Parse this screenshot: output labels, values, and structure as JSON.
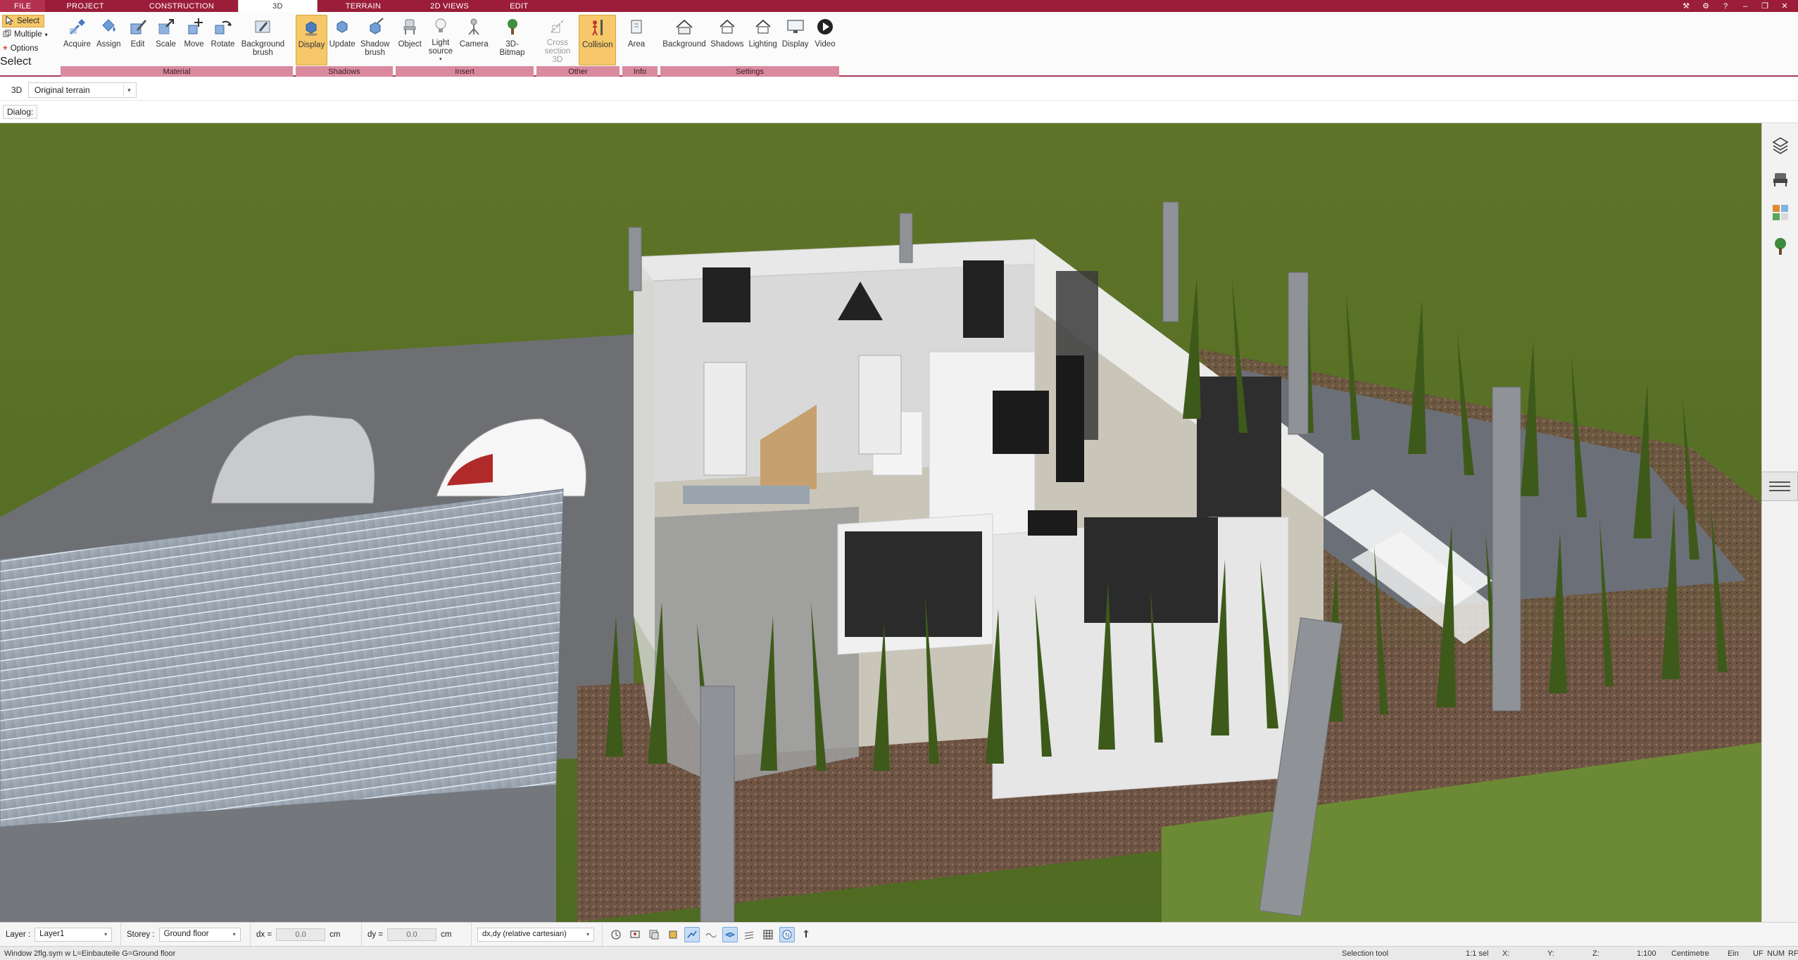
{
  "tabs": [
    {
      "label": "FILE",
      "active": false
    },
    {
      "label": "PROJECT",
      "active": false
    },
    {
      "label": "CONSTRUCTION",
      "active": false
    },
    {
      "label": "3D",
      "active": true
    },
    {
      "label": "TERRAIN",
      "active": false
    },
    {
      "label": "2D VIEWS",
      "active": false
    },
    {
      "label": "EDIT",
      "active": false
    }
  ],
  "ribbon": {
    "select": {
      "select_label": "Select",
      "multiple_label": "Multiple",
      "options_label": "Options",
      "group_label": "Select"
    },
    "material": {
      "group_label": "Material",
      "buttons": [
        "Acquire",
        "Assign",
        "Edit",
        "Scale",
        "Move",
        "Rotate",
        "Background brush"
      ]
    },
    "shadows": {
      "group_label": "Shadows",
      "buttons": [
        "Display",
        "Update",
        "Shadow brush"
      ]
    },
    "insert": {
      "group_label": "Insert",
      "buttons": [
        "Object",
        "Light source",
        "Camera",
        "3D-Bitmap"
      ]
    },
    "other": {
      "group_label": "Other",
      "buttons": [
        "Cross section 3D",
        "Collision"
      ]
    },
    "info": {
      "group_label": "Info",
      "buttons": [
        "Area"
      ]
    },
    "settings": {
      "group_label": "Settings",
      "buttons": [
        "Background",
        "Shadows",
        "Lighting",
        "Display",
        "Video"
      ]
    }
  },
  "view": {
    "mode_label": "3D",
    "terrain_value": "Original terrain",
    "dialog_label": "Dialog:"
  },
  "inputbar": {
    "layer_label": "Layer :",
    "layer_value": "Layer1",
    "storey_label": "Storey :",
    "storey_value": "Ground floor",
    "dx_label": "dx =",
    "dx_value": "0.0",
    "dx_unit": "cm",
    "dy_label": "dy =",
    "dy_value": "0.0",
    "dy_unit": "cm",
    "coord_mode": "dx,dy (relative cartesian)"
  },
  "status": {
    "left_text": "Window 2flg.sym w L=Einbauteile G=Ground floor",
    "tool": "Selection tool",
    "sel": "1:1 sel",
    "x": "X:",
    "y": "Y:",
    "z": "Z:",
    "scale": "1:100",
    "units": "Centimetre",
    "ein": "Ein",
    "uf": "UF",
    "num": "NUM",
    "rf": "RF"
  },
  "colors": {
    "accent": "#9b1d3a",
    "group_label_bg": "#d98a9f",
    "active_button": "#f6c86a"
  }
}
